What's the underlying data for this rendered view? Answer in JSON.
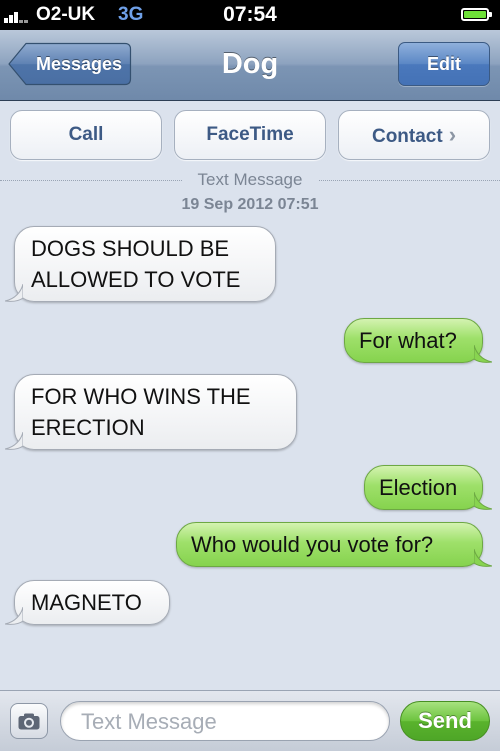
{
  "status_bar": {
    "carrier": "O2-UK",
    "network": "3G",
    "time": "07:54",
    "battery_level": 1.0
  },
  "nav": {
    "back_label": "Messages",
    "title": "Dog",
    "edit_label": "Edit"
  },
  "actions": {
    "call": "Call",
    "facetime": "FaceTime",
    "contact": "Contact"
  },
  "thread": {
    "service_label": "Text Message",
    "date": "19 Sep 2012 07:51"
  },
  "messages": [
    {
      "from": "them",
      "lines": [
        "DOGS SHOULD BE",
        "ALLOWED TO VOTE"
      ]
    },
    {
      "from": "me",
      "lines": [
        "For what?"
      ]
    },
    {
      "from": "them",
      "lines": [
        "FOR WHO WINS THE",
        "ERECTION"
      ]
    },
    {
      "from": "me",
      "lines": [
        "Election"
      ]
    },
    {
      "from": "me",
      "lines": [
        "Who would you vote for?"
      ]
    },
    {
      "from": "them",
      "lines": [
        "MAGNETO"
      ]
    }
  ],
  "composer": {
    "placeholder": "Text Message",
    "send_label": "Send"
  },
  "colors": {
    "background": "#dbe2ed",
    "outgoing_bubble": "#9ee06a",
    "incoming_bubble": "#ffffff",
    "navbar": "#7c95b4",
    "send_button": "#5ab32d"
  }
}
